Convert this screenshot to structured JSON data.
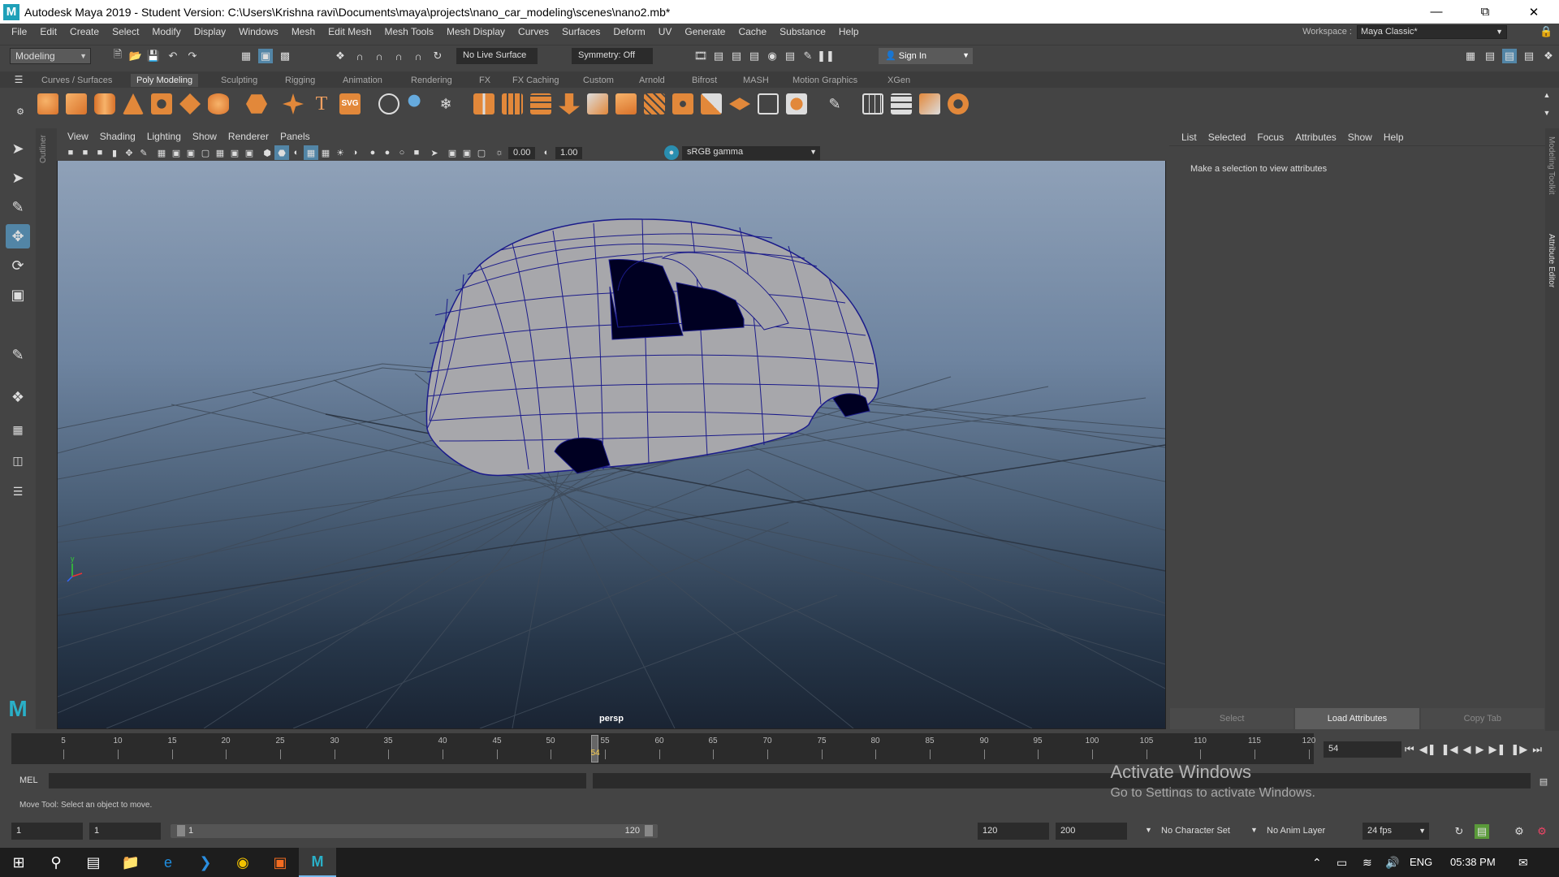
{
  "window": {
    "title": "Autodesk Maya 2019 - Student Version: C:\\Users\\Krishna ravi\\Documents\\maya\\projects\\nano_car_modeling\\scenes\\nano2.mb*",
    "logo": "M",
    "minimize_icon": "minimize-icon",
    "restore_icon": "restore-icon",
    "close_icon": "close-icon"
  },
  "menubar": {
    "items": [
      "File",
      "Edit",
      "Create",
      "Select",
      "Modify",
      "Display",
      "Windows",
      "Mesh",
      "Edit Mesh",
      "Mesh Tools",
      "Mesh Display",
      "Curves",
      "Surfaces",
      "Deform",
      "UV",
      "Generate",
      "Cache",
      "Substance",
      "Help"
    ],
    "workspace_label": "Workspace :",
    "workspace_value": "Maya Classic*"
  },
  "statusline": {
    "menu_set": "Modeling",
    "live_surface": "No Live Surface",
    "symmetry": "Symmetry: Off",
    "sign_in": "Sign In"
  },
  "shelf": {
    "tabs": [
      "Curves / Surfaces",
      "Poly Modeling",
      "Sculpting",
      "Rigging",
      "Animation",
      "Rendering",
      "FX",
      "FX Caching",
      "Custom",
      "Arnold",
      "Bifrost",
      "MASH",
      "Motion Graphics",
      "XGen"
    ],
    "active_tab": "Poly Modeling",
    "text_tool_label": "T",
    "svg_tool_label": "SVG"
  },
  "outliner_label": "Outliner",
  "viewport": {
    "menus": [
      "View",
      "Shading",
      "Lighting",
      "Show",
      "Renderer",
      "Panels"
    ],
    "exposure": "0.00",
    "gamma": "1.00",
    "color_space": "sRGB gamma",
    "camera": "persp",
    "colors": {
      "mesh_fill": "#a7a7ab",
      "wire": "#1b1b8a",
      "grid": "#3f4b5a"
    }
  },
  "attribute_editor": {
    "menus": [
      "List",
      "Selected",
      "Focus",
      "Attributes",
      "Show",
      "Help"
    ],
    "message": "Make a selection to view attributes",
    "buttons": [
      "Select",
      "Load Attributes",
      "Copy Tab"
    ],
    "side_tabs": [
      "Modeling Toolkit",
      "Attribute Editor"
    ]
  },
  "timeline": {
    "labels": [
      "5",
      "10",
      "15",
      "20",
      "25",
      "30",
      "35",
      "40",
      "45",
      "50",
      "55",
      "60",
      "65",
      "70",
      "75",
      "80",
      "85",
      "90",
      "95",
      "100",
      "105",
      "110",
      "115",
      "120"
    ],
    "start": 1,
    "end": 120,
    "current_frame": "54",
    "current_frame_field": "54"
  },
  "command_line": {
    "label": "MEL",
    "help": "Move Tool: Select an object to move."
  },
  "activate_windows": {
    "line1": "Activate Windows",
    "line2": "Go to Settings to activate Windows."
  },
  "range": {
    "start_field": "1",
    "anim_start": "1",
    "range_start": "1",
    "range_end": "120",
    "anim_end": "120",
    "end_field": "200",
    "character_set": "No Character Set",
    "anim_layer": "No Anim Layer",
    "fps": "24 fps"
  },
  "taskbar": {
    "language": "ENG",
    "time": "05:38 PM"
  }
}
